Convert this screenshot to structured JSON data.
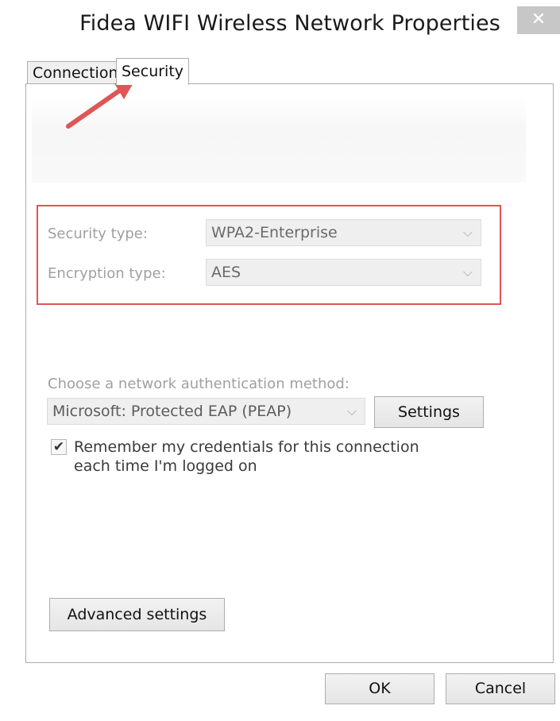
{
  "window": {
    "title": "Fidea WIFI Wireless Network Properties",
    "close_label": "✕"
  },
  "tabs": [
    {
      "label": "Connection",
      "selected": false
    },
    {
      "label": "Security",
      "selected": true
    }
  ],
  "security": {
    "security_type_label": "Security type:",
    "security_type_value": "WPA2-Enterprise",
    "encryption_type_label": "Encryption type:",
    "encryption_type_value": "AES"
  },
  "auth": {
    "method_label": "Choose a network authentication method:",
    "method_value": "Microsoft: Protected EAP (PEAP)",
    "settings_label": "Settings",
    "remember_checked": true,
    "remember_label": "Remember my credentials for this connection each time I'm logged on"
  },
  "advanced_label": "Advanced settings",
  "footer": {
    "ok_label": "OK",
    "cancel_label": "Cancel"
  },
  "colors": {
    "annotation": "#e05557",
    "close_button_bg": "#c7c7c7"
  },
  "icons": {
    "dropdown_chevron": "⌵",
    "checkmark": "✔"
  }
}
